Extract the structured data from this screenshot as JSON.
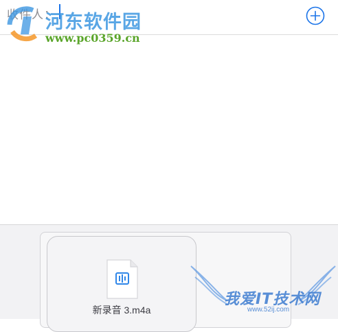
{
  "header": {
    "to_label": "收件人："
  },
  "watermark_top": {
    "title": "河东软件园",
    "url": "www.pc0359.cn"
  },
  "attachment": {
    "file_name": "新录音 3.m4a",
    "icon": "audio-file-icon"
  },
  "watermark_bottom": {
    "title": "我爱IT技术网",
    "url": "www.52ij.com"
  },
  "colors": {
    "accent": "#1a73e8",
    "tray": "#f2f2f4"
  }
}
